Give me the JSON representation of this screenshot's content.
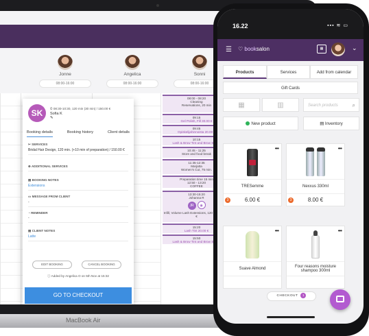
{
  "laptop": {
    "model_label": "MacBook Air",
    "staff": [
      {
        "name": "Jonne",
        "hours": "08:00-16:00"
      },
      {
        "name": "Angelica",
        "hours": "08:00-16:00"
      },
      {
        "name": "Sonni",
        "hours": "08:00-16:00"
      }
    ],
    "events": [
      {
        "time": "08:00 - 08:20",
        "title": "Cleaning",
        "sub": "Reservations, 20 min"
      },
      {
        "time": "09:15",
        "title": "Jenina",
        "sub": "Gel Polish, Fill 30.00 €"
      },
      {
        "time": "09:45",
        "title": "Sanna",
        "sub": "Opiskelijahinnoista 20.00 €"
      },
      {
        "time": "10:15",
        "title": "Sanna",
        "sub": "Lash & Brow Tint and Brow Shape"
      },
      {
        "time": "10:45 - 11:25",
        "title": "Store and food break",
        "sub": ""
      },
      {
        "time": "11:35-12:35",
        "title": "Marjatta",
        "sub": "Women's Cut, 75 min."
      },
      {
        "time": "12:50 - 13:20",
        "title": "COFFEE",
        "sub": "Preparation time 15 min"
      },
      {
        "time": "13:30-15:20",
        "title": "Johanna R",
        "sub": "Infill, Volume Lash Extensions, 120 min · 99.00 €"
      },
      {
        "time": "15:20",
        "title": "Seija L",
        "sub": "Lash Tint 20.00 €"
      },
      {
        "time": "15:50",
        "title": "Maija K",
        "sub": "Lash & Brow Tint and Brow Shape"
      }
    ],
    "booking": {
      "initials": "SK",
      "time_line": "08:30-10:30, 120 min (30 min) / 150.00 €",
      "client": "Sofia K",
      "tabs": [
        "Booking details",
        "Booking history",
        "Client details"
      ],
      "services_label": "SERVICES",
      "services_value": "Bridal Hair Design, 120 min. (+10 min of preparation) / 150.00 €",
      "additional_label": "ADDITIONAL SERVICES",
      "notes_label": "BOOKING NOTES",
      "notes_value": "Extensions",
      "message_label": "MESSAGE FROM CLIENT",
      "message_value": "-",
      "reminder_label": "REMINDER",
      "reminder_value": "-",
      "client_notes_label": "CLIENT NOTES",
      "client_notes_value": "Latte",
      "edit_label": "EDIT BOOKING",
      "cancel_label": "CANCEL BOOKING",
      "added_by": "Added by Angelica O on 5th Nov at 15:32",
      "checkout_label": "GO TO CHECKOUT"
    }
  },
  "phone": {
    "time": "16.22",
    "status_icons": "▪▪▪ ≋ ▭",
    "brand_prefix": "book",
    "brand_suffix": "salon",
    "tabs": [
      "Products",
      "Services",
      "Add from calendar"
    ],
    "gift_cards": "Gift Cards",
    "search_placeholder": "Search products",
    "new_product": "New product",
    "inventory": "Inventory",
    "products": [
      {
        "name": "TRESemme",
        "price": "6.00 €",
        "badge": "3"
      },
      {
        "name": "Nexxus 330ml",
        "price": "8.00 €",
        "badge": "3"
      },
      {
        "name": "Suave Almond",
        "price": "",
        "badge": ""
      },
      {
        "name": "Four reasons moisture shampoo 300ml",
        "price": "",
        "badge": ""
      }
    ],
    "checkout_label": "CHECKOUT",
    "checkout_count": "1"
  },
  "colors": {
    "brand_purple": "#4d2f63",
    "accent_blue": "#3d8ee0",
    "avatar_purple": "#b65ab9"
  }
}
